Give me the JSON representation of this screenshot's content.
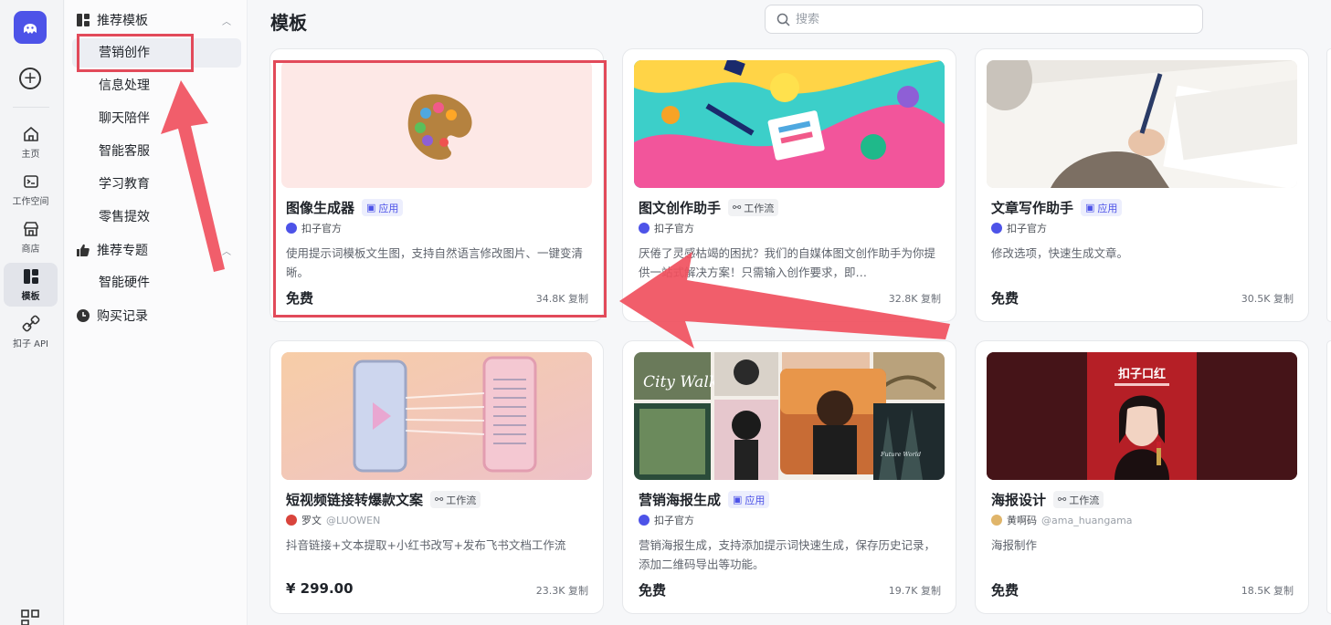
{
  "rail": {
    "items": [
      {
        "label": "主页",
        "icon": "home-icon"
      },
      {
        "label": "工作空间",
        "icon": "workspace-icon"
      },
      {
        "label": "商店",
        "icon": "store-icon"
      },
      {
        "label": "模板",
        "icon": "template-icon",
        "active": true
      },
      {
        "label": "扣子 API",
        "icon": "api-icon"
      }
    ]
  },
  "sidebar": {
    "section1": {
      "label": "推荐模板",
      "icon": "grid-icon",
      "expanded": true
    },
    "section1_items": [
      "营销创作",
      "信息处理",
      "聊天陪伴",
      "智能客服",
      "学习教育",
      "零售提效"
    ],
    "section2": {
      "label": "推荐专题",
      "icon": "thumbs-up-icon",
      "expanded": true
    },
    "section2_items": [
      "智能硬件"
    ],
    "section3": {
      "label": "购买记录",
      "icon": "clock-icon"
    },
    "active_item": "营销创作"
  },
  "main": {
    "title": "模板",
    "search_placeholder": "搜索"
  },
  "cards": [
    {
      "title": "图像生成器",
      "tag": "应用",
      "tag_type": "app",
      "author": "扣子官方",
      "handle": "",
      "desc": "使用提示词模板文生图，支持自然语言修改图片、一键变清晰。",
      "price": "免费",
      "copies": "34.8K 复制"
    },
    {
      "title": "图文创作助手",
      "tag": "工作流",
      "tag_type": "flow",
      "author": "扣子官方",
      "handle": "",
      "desc": "厌倦了灵感枯竭的困扰？我们的自媒体图文创作助手为你提供一站式解决方案！只需输入创作要求，即…",
      "price": "",
      "copies": "32.8K 复制"
    },
    {
      "title": "文章写作助手",
      "tag": "应用",
      "tag_type": "app",
      "author": "扣子官方",
      "handle": "",
      "desc": "修改选项，快速生成文章。",
      "price": "免费",
      "copies": "30.5K 复制"
    },
    {
      "title": "短视频链接转爆款文案",
      "tag": "工作流",
      "tag_type": "flow",
      "author": "罗文",
      "handle": "@LUOWEN",
      "desc": "抖音链接+文本提取+小红书改写+发布飞书文档工作流",
      "price": "¥ 299.00",
      "copies": "23.3K 复制"
    },
    {
      "title": "营销海报生成",
      "tag": "应用",
      "tag_type": "app",
      "author": "扣子官方",
      "handle": "",
      "desc": "营销海报生成，支持添加提示词快速生成，保存历史记录，添加二维码导出等功能。",
      "price": "免费",
      "copies": "19.7K 复制"
    },
    {
      "title": "海报设计",
      "tag": "工作流",
      "tag_type": "flow",
      "author": "黄啊码",
      "handle": "@ama_huangama",
      "desc": "海报制作",
      "price": "免费",
      "copies": "18.5K 复制"
    }
  ],
  "thumbnail_text": {
    "city_walk": "City Walk",
    "future_world": "Future World",
    "poster_title": "扣子口红"
  },
  "colors": {
    "accent": "#4d53e8",
    "annotation": "#e24a5a"
  }
}
